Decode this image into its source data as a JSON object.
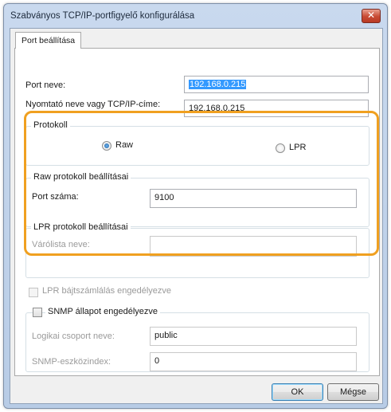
{
  "window": {
    "title": "Szabványos TCP/IP-portfigyelő konfigurálása",
    "close_symbol": "✕"
  },
  "tab": {
    "label": "Port beállítása"
  },
  "port_name": {
    "label": "Port neve:",
    "value": "192.168.0.215"
  },
  "printer_address": {
    "label": "Nyomtató neve vagy TCP/IP-címe:",
    "value": "192.168.0.215"
  },
  "protocol": {
    "title": "Protokoll",
    "raw_label": "Raw",
    "lpr_label": "LPR",
    "selected": "Raw"
  },
  "raw_settings": {
    "title": "Raw protokoll beállításai",
    "port_number_label": "Port száma:",
    "port_number_value": "9100"
  },
  "lpr_settings": {
    "title": "LPR protokoll beállításai",
    "queue_label": "Várólista neve:",
    "queue_value": ""
  },
  "lpr_byte_counting": {
    "label": "LPR bájtszámlálás engedélyezve",
    "checked": false
  },
  "snmp": {
    "label": "SNMP állapot engedélyezve",
    "checked": false,
    "community_label": "Logikai csoport neve:",
    "community_value": "public",
    "device_index_label": "SNMP-eszközindex:",
    "device_index_value": "0"
  },
  "buttons": {
    "ok": "OK",
    "cancel": "Mégse"
  },
  "colors": {
    "highlight": "#f0a020",
    "selection": "#3399ff"
  }
}
